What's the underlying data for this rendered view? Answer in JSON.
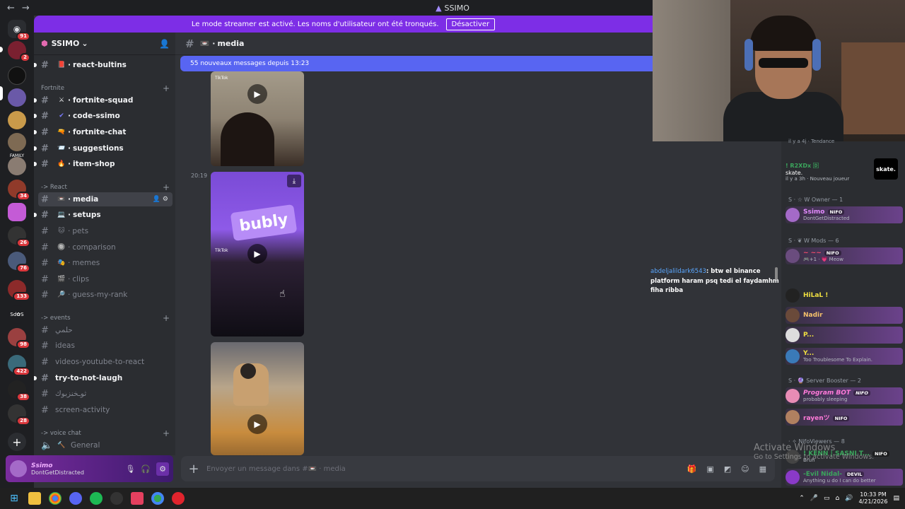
{
  "window": {
    "title": "SSIMO",
    "back": "←",
    "forward": "→"
  },
  "banner": {
    "text": "Le mode streamer est activé. Les noms d'utilisateur ont été tronqués.",
    "button": "Désactiver"
  },
  "rail": {
    "badges": [
      "91",
      "2",
      "34",
      "26",
      "76",
      "133",
      "98",
      "422",
      "38",
      "28"
    ],
    "labels": {
      "family": "FAMILY",
      "sd": "Sd✿S"
    },
    "add": "+"
  },
  "guild": {
    "name": "SSIMO",
    "chevron": "⌄"
  },
  "channels": {
    "top": {
      "emoji": "📕",
      "name": "react-bultins"
    },
    "cat_fortnite": "Fortnite",
    "fortnite": [
      {
        "emoji": "⚔",
        "name": "fortnite-squad"
      },
      {
        "emoji": "✔",
        "name": "code-ssimo"
      },
      {
        "emoji": "🔫",
        "name": "fortnite-chat"
      },
      {
        "emoji": "📨",
        "name": "suggestions"
      },
      {
        "emoji": "🔥",
        "name": "item-shop"
      }
    ],
    "cat_react": "-> React",
    "react": [
      {
        "emoji": "📼",
        "name": "media"
      },
      {
        "emoji": "💻",
        "name": "setups"
      },
      {
        "emoji": "🐱",
        "name": "pets"
      },
      {
        "emoji": "🔘",
        "name": "comparison"
      },
      {
        "emoji": "🎭",
        "name": "memes"
      },
      {
        "emoji": "🎬",
        "name": "clips"
      },
      {
        "emoji": "🔎",
        "name": "guess-my-rank"
      }
    ],
    "cat_events": "-> events",
    "events": [
      {
        "name": "حلمي"
      },
      {
        "name": "ideas"
      },
      {
        "name": "videos-youtube-to-react"
      },
      {
        "name": "try-to-not-laugh"
      },
      {
        "name": "ثوـخنزبوك"
      },
      {
        "name": "screen-activity"
      }
    ],
    "cat_voice": "-> voice chat",
    "voice": {
      "emoji": "🔨",
      "name": "General"
    }
  },
  "user": {
    "name": "Ssimo",
    "status": "DontGetDistracted"
  },
  "chat": {
    "channel": "media",
    "new_messages": "55 nouveaux messages depuis 13:23",
    "timestamp": "20:19",
    "tiktok": "TikTok",
    "placeholder": "Envoyer un message dans #📼 · media",
    "add": "+"
  },
  "overlay_chat": {
    "user": "abdeljalildark6543",
    "text": ": btw el binance platform haram psq tedi el faydamhm fiha ribba"
  },
  "members": {
    "top_partial": "il y a 4j · Tendance",
    "r2x": {
      "name": "! R2XDx 🄳",
      "status": "skate.",
      "meta": "il y a 3h · Nouveau joueur",
      "logo": "skate."
    },
    "g_owner": "S · ☆ W Owner — 1",
    "owner": {
      "name": "Ssimo",
      "tag": "NIFO",
      "status": "DontGetDistracted"
    },
    "g_mods": "S · ❦ W Mods — 6",
    "mods": [
      {
        "name": "~ ~~",
        "tag": "NIFO",
        "status": "🎮+1 · 💗 Meow"
      },
      {
        "name": "HiLaL !",
        "tag": "",
        "status": ""
      },
      {
        "name": "Nadir",
        "tag": "",
        "status": ""
      },
      {
        "name": "P...",
        "tag": "",
        "status": ""
      },
      {
        "name": "Y...",
        "tag": "",
        "status": "Too Troublesome To Explain."
      }
    ],
    "g_boost": "S · 🔮 Server Booster — 2",
    "boost": [
      {
        "name": "Program BOT",
        "tag": "NIFO",
        "status": "probably sleeping"
      },
      {
        "name": "rayenツ",
        "tag": "NIFO",
        "status": ""
      }
    ],
    "g_viewers": "· ✧ NifoViewers — 8",
    "viewers": [
      {
        "name": "! KENN | SASNI T...",
        "tag": "NIFO",
        "status": "Bruh"
      },
      {
        "name": "-Evil Nidal-",
        "tag": "DEVIL",
        "status": "Anything u do I can do better"
      }
    ]
  },
  "watermark": {
    "line1": "Activate Windows",
    "line2": "Go to Settings to activate Windows."
  },
  "taskbar": {
    "time": "10:33 PM",
    "date": "4/21/2026"
  },
  "colors": {
    "accent": "#5865f2",
    "banner": "#7d2ee6",
    "bg": "#313338",
    "sidebar": "#2b2d31",
    "rail": "#1e1f22"
  }
}
